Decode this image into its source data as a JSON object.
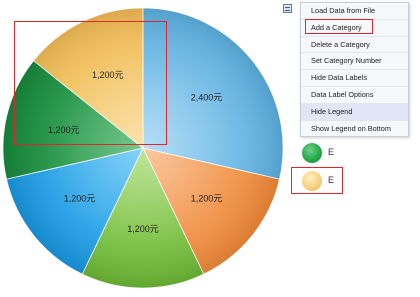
{
  "chart_data": {
    "type": "pie",
    "slices": [
      {
        "label": "2,400元",
        "value": 2400,
        "color": "#8ccbf0",
        "edge": "#5aaede"
      },
      {
        "label": "1,200元",
        "value": 1200,
        "color": "#f8aa6c",
        "edge": "#ed8736"
      },
      {
        "label": "1,200元",
        "value": 1200,
        "color": "#9bd762",
        "edge": "#6ab533"
      },
      {
        "label": "1,200元",
        "value": 1200,
        "color": "#45b9f5",
        "edge": "#1696df"
      },
      {
        "label": "1,200元",
        "value": 1200,
        "color": "#2ea952",
        "edge": "#15863a"
      },
      {
        "label": "1,200元",
        "value": 1200,
        "color": "#f8d27c",
        "edge": "#efb952"
      }
    ],
    "start_angle_deg": 0,
    "direction": "clockwise"
  },
  "menu": {
    "items": [
      {
        "label": "Load Data from File",
        "active": false,
        "highlighted": false
      },
      {
        "label": "Add a Category",
        "active": false,
        "highlighted": true
      },
      {
        "label": "Delete a Category",
        "active": false,
        "highlighted": false
      },
      {
        "label": "Set Category Number",
        "active": false,
        "highlighted": false
      },
      {
        "label": "Hide Data Labels",
        "active": false,
        "highlighted": false
      },
      {
        "label": "Data Label Options",
        "active": false,
        "highlighted": false
      },
      {
        "label": "Hide Legend",
        "active": true,
        "highlighted": false
      },
      {
        "label": "Show Legend on Bottom",
        "active": false,
        "highlighted": false
      }
    ]
  },
  "legend": {
    "items": [
      {
        "label": "E",
        "color": "#27a94c"
      },
      {
        "label": "E",
        "color": "#f6d17f"
      }
    ]
  },
  "highlight_color": "#e0252d"
}
